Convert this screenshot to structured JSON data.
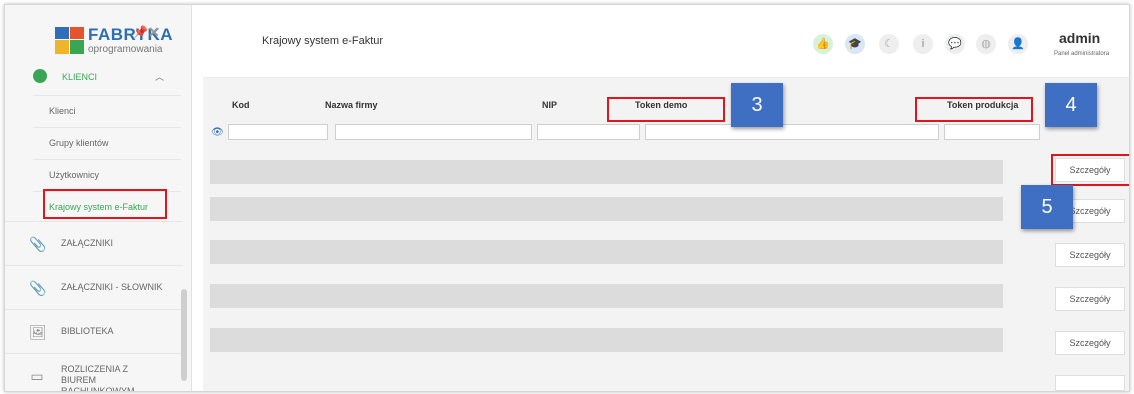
{
  "brand": {
    "title": "FABRYKA",
    "subtitle": "oprogramowania"
  },
  "sidebar": {
    "group": {
      "label": "KLIENCI"
    },
    "subitems": [
      {
        "label": "Klienci"
      },
      {
        "label": "Grupy klientów"
      },
      {
        "label": "Użytkownicy"
      },
      {
        "label": "Krajowy system e-Faktur",
        "active": true
      }
    ],
    "items": [
      {
        "label": "ZAŁĄCZNIKI",
        "icon": "paperclip-icon"
      },
      {
        "label": "ZAŁĄCZNIKI - SŁOWNIK",
        "icon": "paperclip-icon"
      },
      {
        "label": "BIBLIOTEKA",
        "icon": "image-icon"
      },
      {
        "label": "ROZLICZENIA Z BIUREM RACHUNKOWYM",
        "icon": "card-icon"
      }
    ]
  },
  "header": {
    "title": "Krajowy system e-Faktur",
    "icons": [
      "thumbs-up-icon",
      "graduation-cap-icon",
      "moon-icon",
      "info-icon",
      "chat-icon",
      "globe-icon",
      "user-icon"
    ],
    "user": {
      "name": "admin",
      "role": "Panel administratora"
    }
  },
  "table": {
    "columns": [
      "Kod",
      "Nazwa firmy",
      "NIP",
      "Token demo",
      "Token produkcja"
    ],
    "row_action": "Szczegóły",
    "row_count": 5
  },
  "callouts": [
    "3",
    "4",
    "5"
  ],
  "colors": {
    "accent_green": "#3aa655",
    "brand_blue": "#2c6fb3",
    "highlight_red": "#e0161c",
    "callout_blue": "#3e6fc3"
  }
}
